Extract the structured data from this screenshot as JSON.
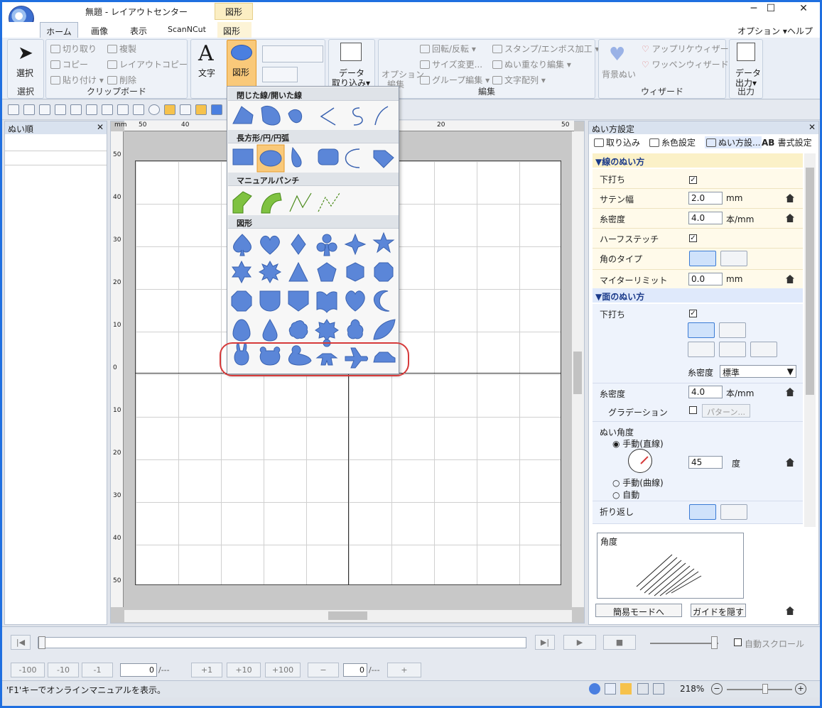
{
  "window": {
    "title": "無題 - レイアウトセンター",
    "context_tab": "図形",
    "minimize": "─",
    "maximize": "☐",
    "close": "✕"
  },
  "tabs": [
    "ホーム",
    "画像",
    "表示",
    "ScanNCut",
    "図形"
  ],
  "right_menu": {
    "options": "オプション",
    "help": "ヘルプ"
  },
  "ribbon": {
    "select": {
      "label": "選択",
      "group": "選択"
    },
    "clipboard": {
      "cut": "切り取り",
      "copy": "コピー",
      "paste": "貼り付け",
      "dup": "複製",
      "layout_copy": "レイアウトコピー",
      "delete": "削除",
      "group": "クリップボード"
    },
    "text": {
      "label": "文字"
    },
    "shape": {
      "label": "図形"
    },
    "import": {
      "label1": "データ",
      "label2": "取り込み"
    },
    "edit": {
      "option": "オプション",
      "edit": "編集",
      "rotate": "回転/反転",
      "size": "サイズ変更...",
      "group_edit": "グループ編集",
      "stamp": "スタンプ/エンボス加工",
      "overlap": "ぬい重なり編集",
      "text_arrange": "文字配列",
      "group": "編集"
    },
    "wizard": {
      "bg": "背景ぬい",
      "applique": "アップリケウィザード",
      "wappen": "ワッペンウィザード",
      "group": "ウィザード"
    },
    "output": {
      "label1": "データ",
      "label2": "出力",
      "group": "出力"
    }
  },
  "left_panel": {
    "title": "ぬい順"
  },
  "ruler": {
    "unit": "mm",
    "h_ticks": [
      "50",
      "40",
      "20",
      "50"
    ],
    "v_ticks": [
      "50",
      "40",
      "30",
      "20",
      "10",
      "0",
      "10",
      "20",
      "30",
      "40",
      "50"
    ]
  },
  "dropdown": {
    "sec1": "閉じた線/開いた線",
    "sec2": "長方形/円/円弧",
    "sec3": "マニュアルパンチ",
    "sec4": "図形"
  },
  "right_panel": {
    "title": "ぬい方設定",
    "tabs": [
      "取り込み",
      "糸色設定",
      "ぬい方設...",
      "書式設定"
    ],
    "line_section": "▼線のぬい方",
    "rows_line": [
      {
        "label": "下打ち"
      },
      {
        "label": "サテン幅",
        "value": "2.0",
        "unit": "mm"
      },
      {
        "label": "糸密度",
        "value": "4.0",
        "unit": "本/mm"
      },
      {
        "label": "ハーフステッチ"
      },
      {
        "label": "角のタイプ"
      },
      {
        "label": "マイターリミット",
        "value": "0.0",
        "unit": "mm"
      }
    ],
    "face_section": "▼面のぬい方",
    "face": {
      "underlay": "下打ち",
      "density_label": "糸密度",
      "density_select": "標準",
      "density2_label": "糸密度",
      "density2_value": "4.0",
      "density2_unit": "本/mm",
      "gradation": "グラデーション",
      "pattern_btn": "パターン...",
      "angle_label": "ぬい角度",
      "manual_line": "手動(直線)",
      "angle_value": "45",
      "angle_unit": "度",
      "manual_curve": "手動(曲線)",
      "auto": "自動",
      "fold": "折り返し"
    },
    "preview_label": "角度",
    "simple_mode": "簡易モードへ",
    "hide_guide": "ガイドを隠す"
  },
  "bottom": {
    "btns": [
      "-100",
      "-10",
      "-1",
      "+1",
      "+10",
      "+100",
      "−",
      "+"
    ],
    "field1": "0",
    "field1_suffix": "/---",
    "field2": "0",
    "field2_suffix": "/---",
    "auto_scroll": "自動スクロール"
  },
  "status": {
    "text": "'F1'キーでオンラインマニュアルを表示。",
    "zoom": "218%"
  }
}
